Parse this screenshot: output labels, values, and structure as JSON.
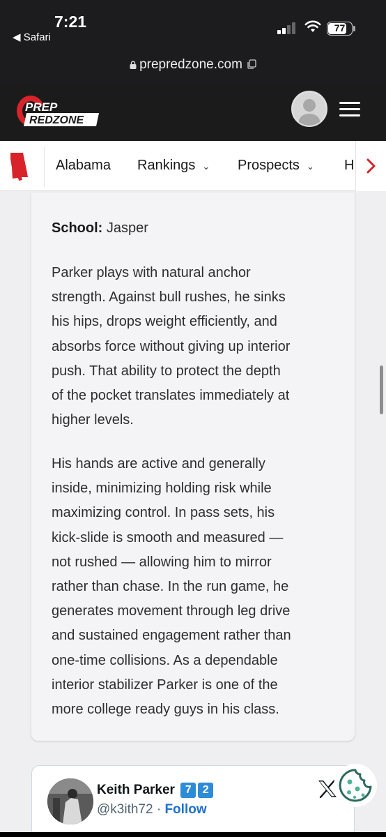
{
  "status_bar": {
    "time": "7:21",
    "back_app": "◀ Safari",
    "battery": "77"
  },
  "browser": {
    "url": "prepredzone.com"
  },
  "site": {
    "logo_line1": "PREP",
    "logo_line2": "REDZONE",
    "colors": {
      "brand_red": "#d8232a",
      "header_bg": "#1b1b1b"
    }
  },
  "nav": {
    "items": [
      {
        "label": "Alabama",
        "has_dropdown": false
      },
      {
        "label": "Rankings",
        "has_dropdown": true
      },
      {
        "label": "Prospects",
        "has_dropdown": true
      },
      {
        "label": "H",
        "has_dropdown": false
      }
    ],
    "dropdown_glyph": "⌄",
    "next_glyph": "›"
  },
  "article": {
    "school_label": "School:",
    "school_value": "Jasper",
    "paragraph1_lines": [
      "Parker plays with natural anchor",
      "strength. Against bull rushes, he sinks",
      "his hips, drops weight efficiently, and",
      "absorbs force without giving up interior",
      "push. That ability to protect the depth",
      "of the pocket translates immediately at",
      "higher levels."
    ],
    "paragraph2_lines": [
      "His hands are active and generally",
      "inside, minimizing holding risk while",
      "maximizing control. In pass sets, his",
      "kick-slide is smooth and measured —",
      "not rushed — allowing him to mirror",
      "rather than chase. In the run game, he",
      "generates movement through leg drive",
      "and sustained engagement rather than",
      "one-time collisions. As a dependable",
      "interior stabilizer Parker is one of the",
      "more college ready guys in his class."
    ]
  },
  "tweet": {
    "name": "Keith Parker",
    "badge_digits": [
      "7",
      "2"
    ],
    "handle": "@k3ith72",
    "separator": " · ",
    "follow_label": "Follow"
  }
}
